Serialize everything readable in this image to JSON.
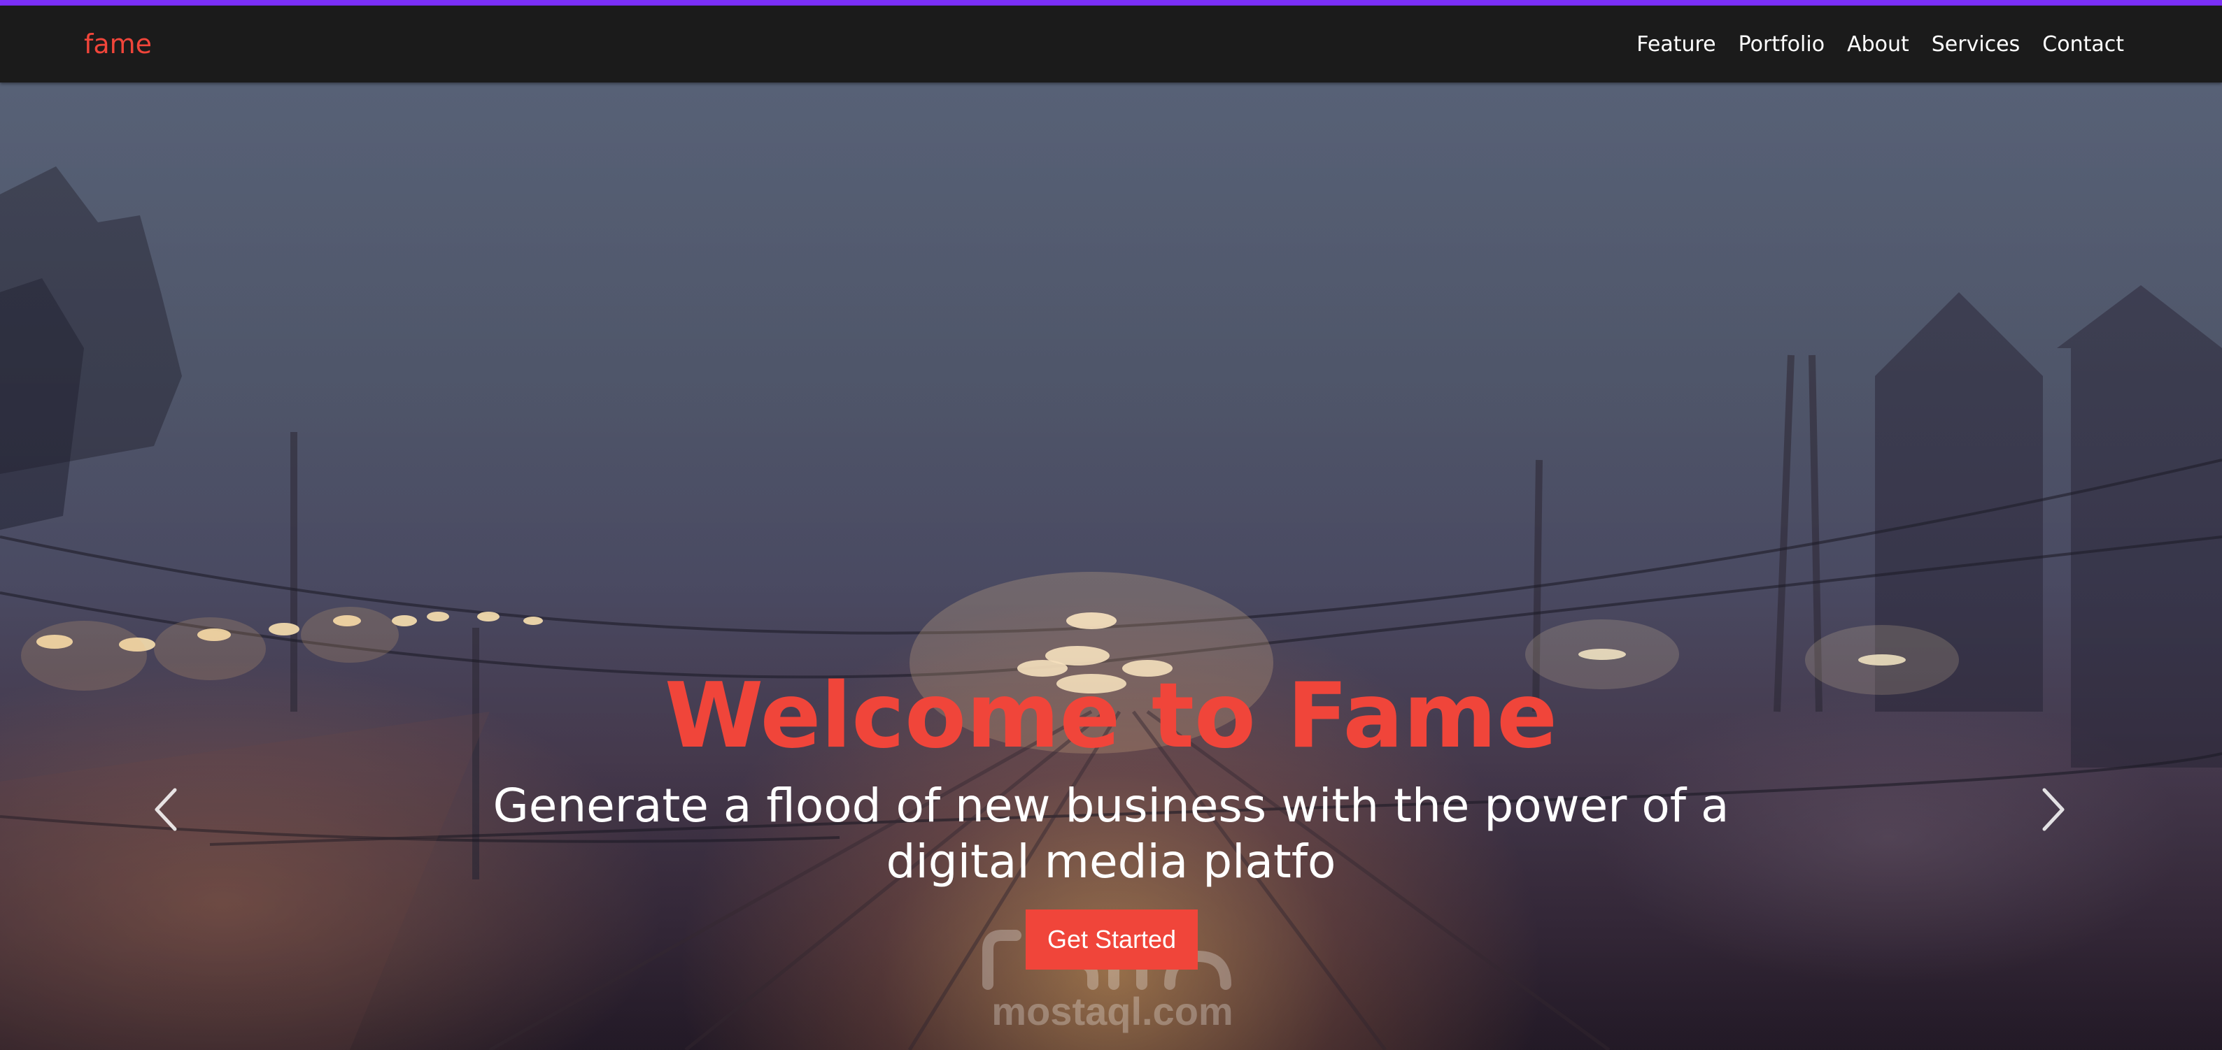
{
  "navbar": {
    "brand": "fame",
    "links": [
      "Feature",
      "Portfolio",
      "About",
      "Services",
      "Contact"
    ]
  },
  "hero": {
    "title": "Welcome to Fame",
    "subtitle": "Generate a flood of new business with the power of a digital media platfo",
    "cta_label": "Get Started"
  },
  "carousel": {
    "prev_icon": "chevron-left-icon",
    "next_icon": "chevron-right-icon"
  },
  "watermark": {
    "text": "mostaql.com"
  },
  "colors": {
    "accent_line": "#7b2ff7",
    "navbar_bg": "#1b1b1b",
    "brand": "#f0453a",
    "nav_text": "#ffffff",
    "cta_bg": "#f0453a",
    "title": "#f0453a"
  }
}
